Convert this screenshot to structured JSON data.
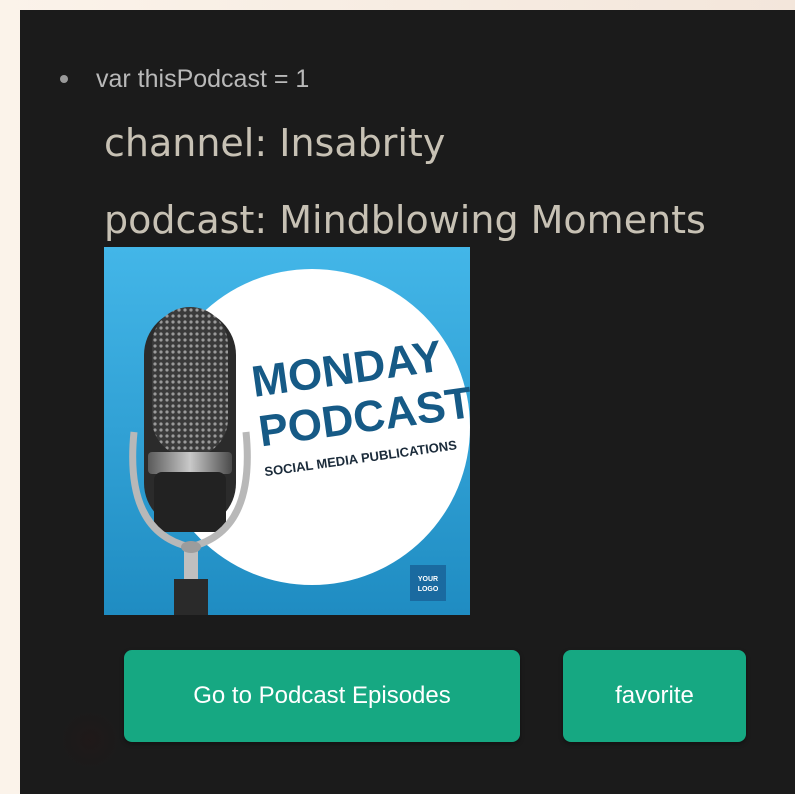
{
  "podcast_item": {
    "var_line": "var thisPodcast = 1",
    "channel_line": "channel: Insabrity",
    "podcast_line": "podcast: Mindblowing Moments",
    "cover": {
      "title_line1": "MONDAY",
      "title_line2": "PODCAST",
      "tagline": "SOCIAL MEDIA PUBLICATIONS",
      "logo_line1": "YOUR",
      "logo_line2": "LOGO"
    },
    "buttons": {
      "episodes_label": "Go to Podcast Episodes",
      "favorite_label": "favorite"
    }
  },
  "colors": {
    "panel_bg": "#1b1b1b",
    "button_bg": "#16a882",
    "cover_blue": "#2a9fd4",
    "cover_title": "#165a86"
  },
  "icons": {
    "cover_art": "microphone-icon"
  }
}
